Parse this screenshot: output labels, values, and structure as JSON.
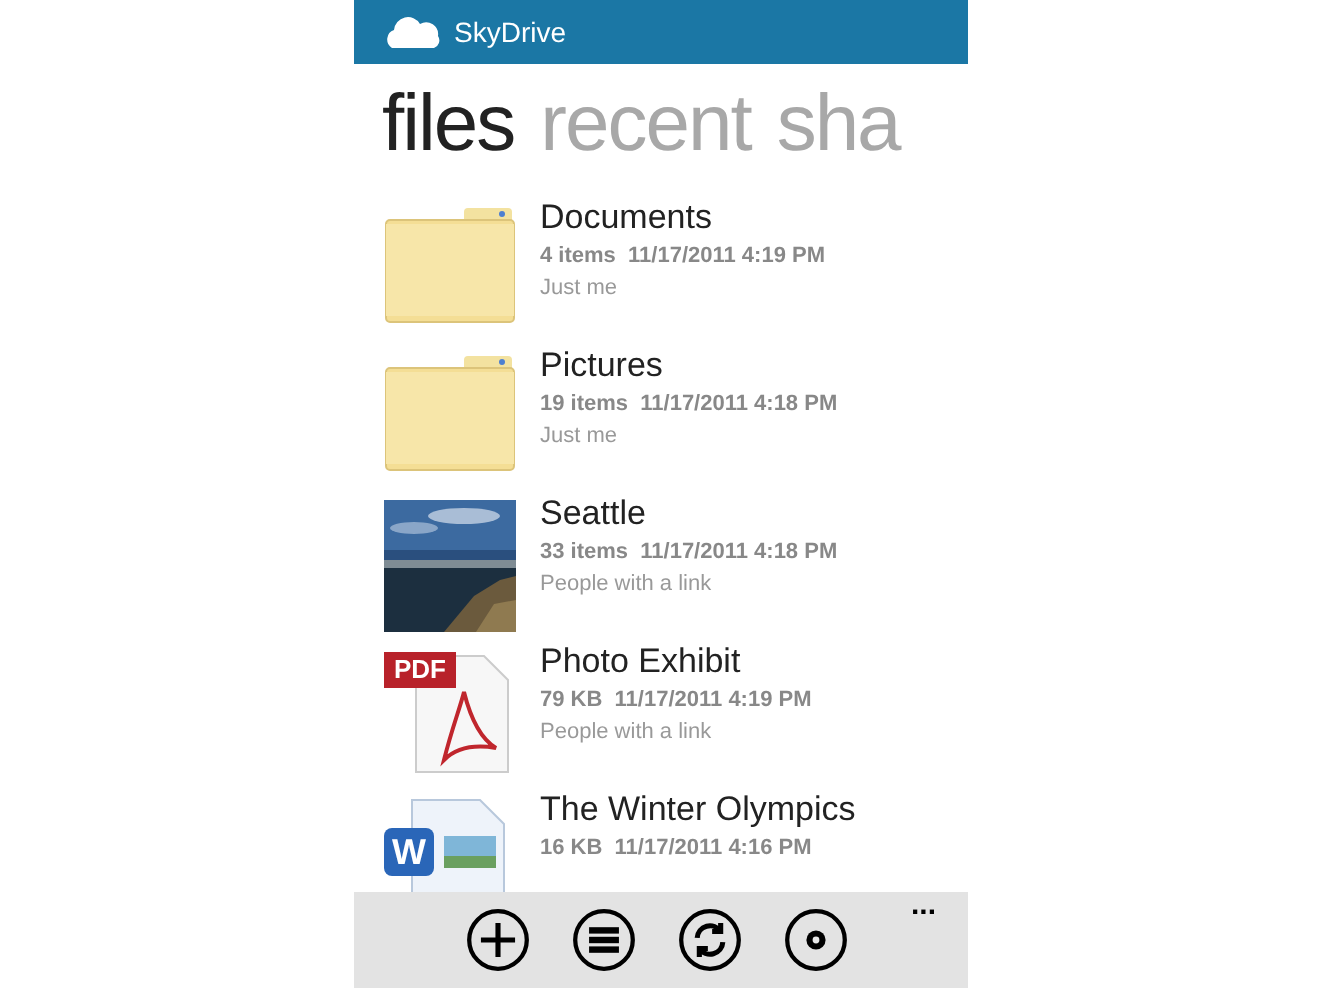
{
  "header": {
    "title": "SkyDrive"
  },
  "pivots": [
    {
      "label": "files",
      "selected": true
    },
    {
      "label": "recent",
      "selected": false
    },
    {
      "label": "sha",
      "selected": false
    }
  ],
  "files": [
    {
      "kind": "folder",
      "name": "Documents",
      "meta": "4 items  11/17/2011 4:19 PM",
      "sharing": "Just me"
    },
    {
      "kind": "folder",
      "name": "Pictures",
      "meta": "19 items  11/17/2011 4:18 PM",
      "sharing": "Just me"
    },
    {
      "name": "Seattle",
      "meta": "33 items  11/17/2011 4:18 PM",
      "sharing": "People with a link"
    },
    {
      "kind": "pdf",
      "badge": "PDF",
      "name": "Photo Exhibit",
      "meta": "79 KB  11/17/2011 4:19 PM",
      "sharing": "People with a link"
    },
    {
      "kind": "word",
      "badge": "W",
      "name": "The Winter Olympics",
      "meta": "16 KB  11/17/2011 4:16 PM"
    }
  ],
  "app_bar": {
    "buttons": [
      {
        "kind": "add"
      },
      {
        "kind": "select"
      },
      {
        "kind": "sync"
      },
      {
        "kind": "settings"
      }
    ],
    "more": "..."
  }
}
